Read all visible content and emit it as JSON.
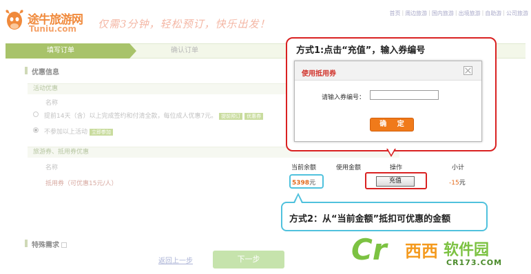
{
  "header": {
    "logo_cn": "途牛旅游网",
    "logo_en": "Tuniu.com",
    "slogan": "仅需3分钟，轻松预订，快乐出发！",
    "nav": [
      "首页",
      "周边旅游",
      "国内旅游",
      "出境旅游",
      "自助游",
      "公司旅游"
    ]
  },
  "steps": {
    "step1": "填写订单",
    "step2": "确认订单"
  },
  "preferential": {
    "title": "优惠信息",
    "activity_head": "活动优惠",
    "name_col": "名称",
    "option1": "提前14天（含）以上完成签约和付清全款，每位成人优惠7元。",
    "option1_tags": [
      "提前预订",
      "优惠券"
    ],
    "option2": "不参加以上活动",
    "option2_tag": "立即参加",
    "coupon_head": "旅游券、抵用券优惠",
    "coupon_name_col": "名称",
    "coupon_item": "抵用券（可优惠15元/人）"
  },
  "table": {
    "headers": [
      "当前余额",
      "使用金额",
      "操作",
      "小计"
    ],
    "balance_value": "5398",
    "balance_unit": "元",
    "recharge_label": "充值",
    "subtotal_value": "-15",
    "subtotal_unit": "元"
  },
  "callout1": {
    "text": "方式1:点击“充值”，输入券编号"
  },
  "dialog": {
    "title": "使用抵用券",
    "label": "请输入券编号：",
    "input_value": "",
    "ok_label": "确 定"
  },
  "callout2": {
    "text": "方式2：从“当前金额”抵扣可优惠的金额"
  },
  "special": {
    "title": "特殊需求"
  },
  "footer": {
    "back": "返回上一步",
    "next": "下一步"
  },
  "watermark": {
    "cr": "Cr",
    "xixi": "西西",
    "soft": "软件园",
    "url": "CR173.COM"
  },
  "colors": {
    "callout1_border": "#d92020",
    "callout2_border": "#4fc1dd",
    "ok_button": "#f07a1a",
    "accent_green": "#a8c36a"
  }
}
